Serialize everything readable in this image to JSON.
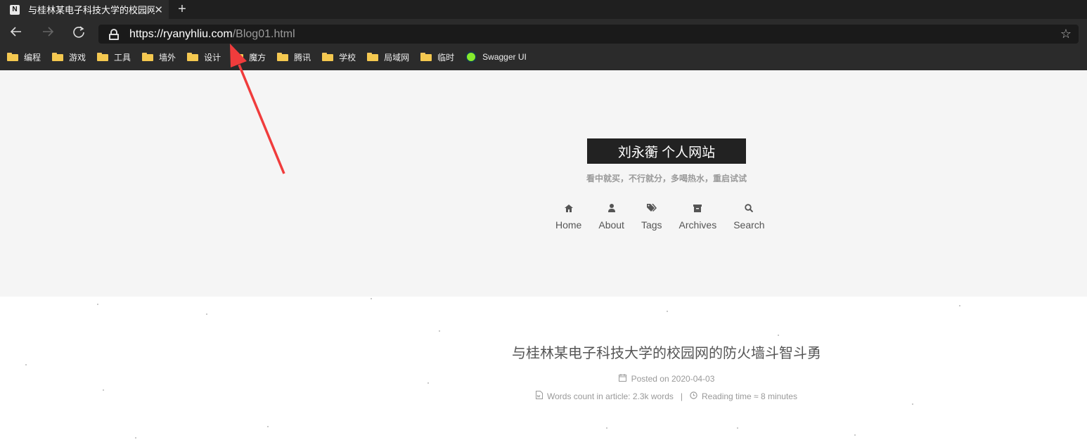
{
  "tab": {
    "favicon_letter": "N",
    "title": "与桂林某电子科技大学的校园网的防火墙斗智斗勇"
  },
  "address": {
    "host": "https://ryanyhliu.com",
    "path": "/Blog01.html"
  },
  "bookmarks": [
    {
      "label": "编程",
      "icon": "folder-icon"
    },
    {
      "label": "游戏",
      "icon": "folder-icon"
    },
    {
      "label": "工具",
      "icon": "folder-icon"
    },
    {
      "label": "墙外",
      "icon": "folder-icon"
    },
    {
      "label": "设计",
      "icon": "folder-icon"
    },
    {
      "label": "魔方",
      "icon": "folder-icon"
    },
    {
      "label": "腾讯",
      "icon": "folder-icon"
    },
    {
      "label": "学校",
      "icon": "folder-icon"
    },
    {
      "label": "局域网",
      "icon": "folder-icon"
    },
    {
      "label": "临时",
      "icon": "folder-icon"
    },
    {
      "label": "Swagger UI",
      "icon": "swagger-icon"
    }
  ],
  "site": {
    "brand": "刘永蘅 个人网站",
    "subtitle": "看中就买，不行就分，多喝热水，重启试试",
    "menu": [
      {
        "label": "Home",
        "icon": "home-icon"
      },
      {
        "label": "About",
        "icon": "user-icon"
      },
      {
        "label": "Tags",
        "icon": "tags-icon"
      },
      {
        "label": "Archives",
        "icon": "archive-icon"
      },
      {
        "label": "Search",
        "icon": "search-icon"
      }
    ]
  },
  "post": {
    "title": "与桂林某电子科技大学的校园网的防火墙斗智斗勇",
    "posted_on_label": "Posted on",
    "date": "2020-04-03",
    "words_count": "Words count in article: 2.3k words",
    "separator": "|",
    "reading_time": "Reading time ≈ 8 minutes"
  },
  "colors": {
    "browser_bg": "#2b2b2b",
    "header_bg": "#f5f5f5",
    "brand_bg": "#222222",
    "arrow": "#f03c3c",
    "folder": "#f4c84f"
  }
}
